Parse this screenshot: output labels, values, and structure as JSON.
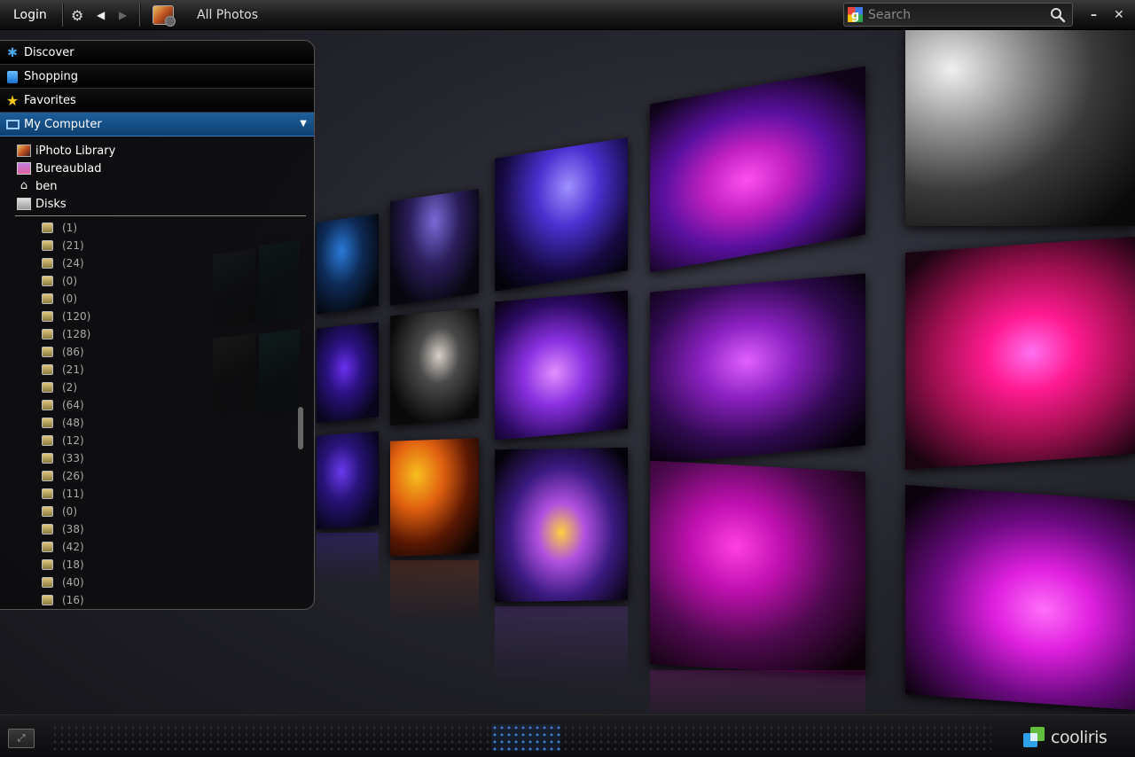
{
  "toolbar": {
    "login_label": "Login",
    "settings_icon": "gear-icon",
    "back_icon": "back-arrow-icon",
    "forward_icon": "forward-arrow-icon",
    "source_icon": "iphoto-icon",
    "source_title": "All Photos"
  },
  "search": {
    "placeholder": "Search",
    "provider_icon": "google-icon"
  },
  "window_controls": {
    "minimize_label": "–",
    "close_label": "✕"
  },
  "sidebar": {
    "sections": [
      {
        "label": "Discover",
        "icon": "discover-icon"
      },
      {
        "label": "Shopping",
        "icon": "shopping-bag-icon"
      },
      {
        "label": "Favorites",
        "icon": "star-icon"
      },
      {
        "label": "My Computer",
        "icon": "computer-icon",
        "expanded": true
      }
    ],
    "tree": [
      {
        "label": "iPhoto Library",
        "icon": "iphoto-icon"
      },
      {
        "label": "Bureaublad",
        "icon": "desktop-icon"
      },
      {
        "label": "ben",
        "icon": "home-icon"
      },
      {
        "label": "Disks",
        "icon": "disk-icon"
      }
    ],
    "folders": [
      "(1)",
      "(21)",
      "(24)",
      "(0)",
      "(0)",
      "(120)",
      "(128)",
      "(86)",
      "(21)",
      "(2)",
      "(64)",
      "(48)",
      "(12)",
      "(33)",
      "(26)",
      "(11)",
      "(0)",
      "(38)",
      "(42)",
      "(18)",
      "(40)",
      "(16)"
    ]
  },
  "bottom": {
    "fullscreen_icon": "fullscreen-icon",
    "brand_name": "cooliris"
  },
  "colors": {
    "accent": "#1e5f9c",
    "page_indicator_active": "#3a78c8"
  }
}
